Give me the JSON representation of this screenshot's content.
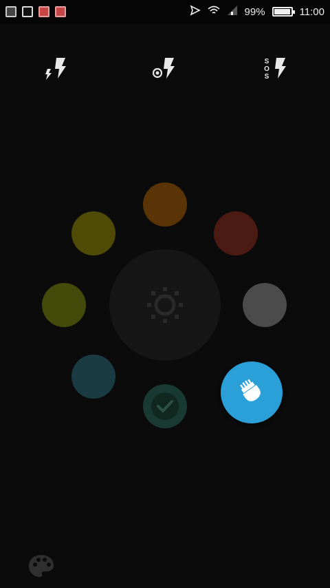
{
  "status_bar": {
    "battery_percent": "99%",
    "battery_level": 0.99,
    "time": "11:00",
    "icons": [
      "gallery-icon",
      "screenshot-icon",
      "notification-icon",
      "notification-icon",
      "send-icon",
      "wifi-icon",
      "signal-icon",
      "battery-icon"
    ]
  },
  "modes": [
    {
      "name": "flash-mode",
      "icon": "flash-icon"
    },
    {
      "name": "strobe-mode",
      "icon": "strobe-flash-icon"
    },
    {
      "name": "sos-mode",
      "icon": "sos-flash-icon",
      "text": "SOS"
    }
  ],
  "colors": {
    "orange": "#5a3407",
    "red": "#4a1a13",
    "gray": "#4b4b4b",
    "yellow": "#4f4a06",
    "olive": "#444a0a",
    "teal": "#1b3b42",
    "green_selected": "#193a32",
    "accent_blue": "#2a9fd8"
  },
  "center": {
    "icon": "brightness-icon"
  },
  "brush": {
    "icon": "brush-icon"
  },
  "bottom": {
    "icon": "palette-icon"
  }
}
